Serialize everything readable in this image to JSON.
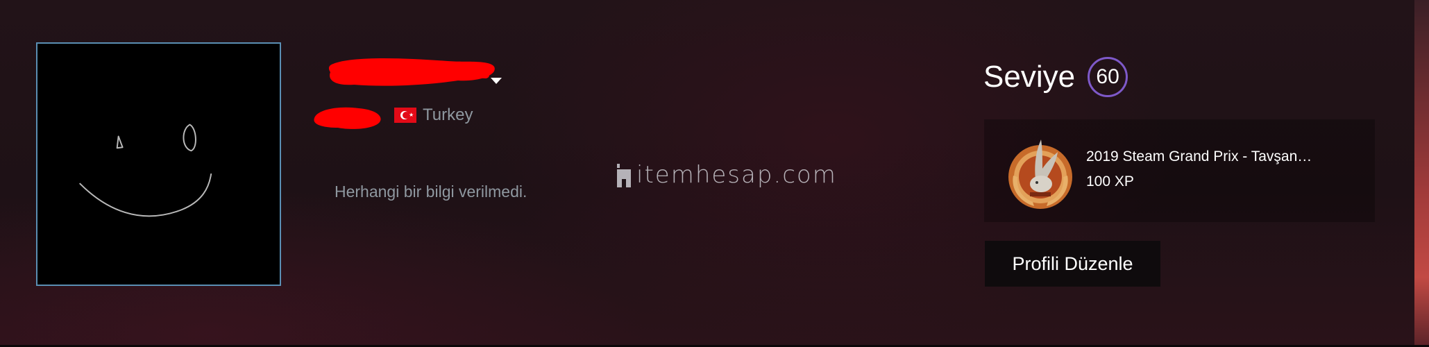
{
  "profile": {
    "country": "Turkey",
    "country_flag_icon": "turkey-flag-icon",
    "summary": "Herhangi bir bilgi verilmedi."
  },
  "watermark": {
    "text": "itemhesap.com"
  },
  "level": {
    "label": "Seviye",
    "value": "60",
    "ring_color": "#7e59c9"
  },
  "featured_badge": {
    "title": "2019 Steam Grand Prix - Tavşan…",
    "xp": "100 XP",
    "icon": "rabbit-medal-icon"
  },
  "actions": {
    "edit_profile_label": "Profili Düzenle"
  },
  "colors": {
    "avatar_border": "#5a8fb4",
    "redaction": "#ff0000",
    "muted_text": "#8f98a0"
  }
}
